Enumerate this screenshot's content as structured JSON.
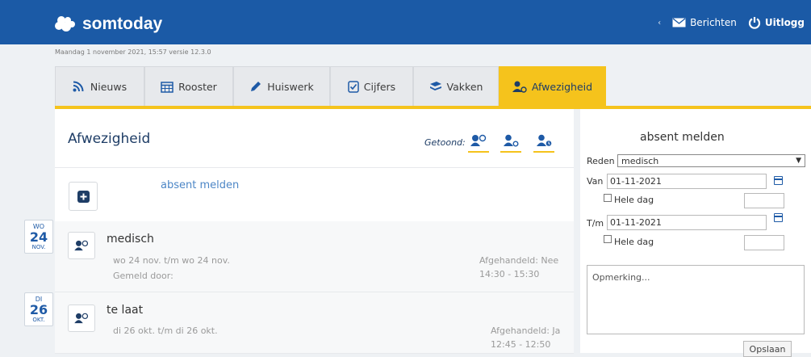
{
  "header": {
    "brand": "somtoday",
    "messages_label": "Berichten",
    "logout_label": "Uitlogg",
    "meta": "Maandag 1 november 2021, 15:57 versie 12.3.0"
  },
  "tabs": [
    {
      "label": "Nieuws",
      "icon": "rss-icon"
    },
    {
      "label": "Rooster",
      "icon": "calendar-icon"
    },
    {
      "label": "Huiswerk",
      "icon": "pencil-icon"
    },
    {
      "label": "Cijfers",
      "icon": "checkbox-icon"
    },
    {
      "label": "Vakken",
      "icon": "books-icon"
    },
    {
      "label": "Afwezigheid",
      "icon": "absence-icon",
      "active": true
    }
  ],
  "main": {
    "title": "Afwezigheid",
    "shown_label": "Getoond:",
    "add_label": "absent melden",
    "entries": [
      {
        "day": "WO",
        "num": "24",
        "month": "NOV.",
        "title": "medisch",
        "range": "wo 24 nov. t/m wo 24 nov.",
        "reported": "Gemeld door:",
        "handled": "Afgehandeld: Nee",
        "time": "14:30 - 15:30"
      },
      {
        "day": "DI",
        "num": "26",
        "month": "OKT.",
        "title": "te laat",
        "range": "di 26 okt. t/m di 26 okt.",
        "reported": "",
        "handled": "Afgehandeld: Ja",
        "time": "12:45 - 12:50"
      }
    ]
  },
  "form": {
    "title": "absent melden",
    "reason_label": "Reden",
    "reason_value": "medisch",
    "from_label": "Van",
    "from_value": "01-11-2021",
    "whole_day_label": "Hele dag",
    "to_label": "T/m",
    "to_value": "01-11-2021",
    "remark_placeholder": "Opmerking...",
    "save_label": "Opslaan"
  },
  "colors": {
    "brand": "#1b5aa6",
    "accent": "#f5c31c",
    "link": "#4c86c6"
  }
}
